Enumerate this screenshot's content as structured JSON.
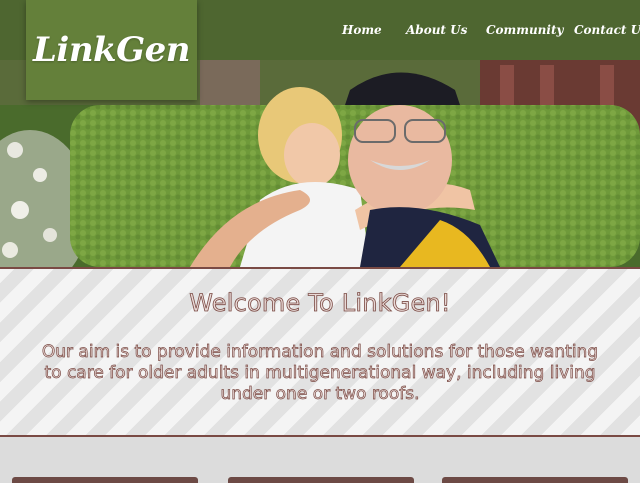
{
  "brand": {
    "logo": "LinkGen"
  },
  "nav": {
    "items": [
      "Home",
      "About Us",
      "Community",
      "Contact Us"
    ]
  },
  "welcome": {
    "title": "Welcome To LinkGen!",
    "body": "Our aim is to provide information and solutions for those wanting to care for older adults in multigenerational way, including living under one or two roofs."
  },
  "colors": {
    "header": "#4e6630",
    "logo_box": "#64803a",
    "accent": "#7a4a44"
  }
}
